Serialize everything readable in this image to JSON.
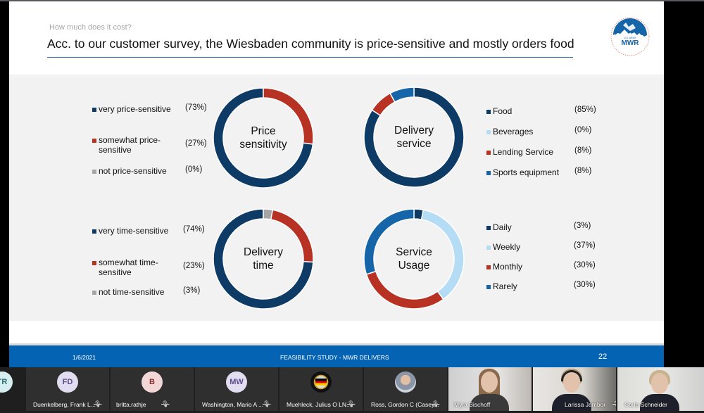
{
  "slide": {
    "subtitle": "How much does it cost?",
    "title": "Acc. to our customer survey, the Wiesbaden community is price-sensitive and mostly orders food",
    "logo": {
      "icon": "us-army-mwr-globe-logo",
      "top_text": "U.S. ARMY",
      "main_text": "MWR"
    },
    "colors": {
      "title_rule": "#2e75b6",
      "panel_bg": "#f2f2f2",
      "footer_bg": "#0563b4"
    },
    "footer": {
      "date": "1/6/2021",
      "center": "FEASIBILITY STUDY - MWR DELIVERS",
      "page": "22"
    }
  },
  "chart_data": [
    {
      "type": "pie",
      "variant": "donut",
      "title": "Price sensitivity",
      "legend_position": "left",
      "categories": [
        "very price-sensitive",
        "somewhat price-sensitive",
        "not price-sensitive"
      ],
      "legend_labels": [
        [
          "very price-sensitive"
        ],
        [
          "somewhat price-",
          "sensitive"
        ],
        [
          "not price-sensitive"
        ]
      ],
      "values": [
        73,
        27,
        0
      ],
      "value_labels": [
        "(73%)",
        "(27%)",
        "(0%)"
      ],
      "colors": [
        "#0d3b66",
        "#b83224",
        "#a5a5a5"
      ]
    },
    {
      "type": "pie",
      "variant": "donut",
      "title": "Delivery service",
      "legend_position": "right",
      "categories": [
        "Food",
        "Beverages",
        "Lending Service",
        "Sports equipment"
      ],
      "legend_labels": [
        [
          "Food"
        ],
        [
          "Beverages"
        ],
        [
          "Lending Service"
        ],
        [
          "Sports equipment"
        ]
      ],
      "values": [
        85,
        0,
        8,
        8
      ],
      "value_labels": [
        "(85%)",
        "(0%)",
        "(8%)",
        "(8%)"
      ],
      "colors": [
        "#0d3b66",
        "#b4dcf5",
        "#b83224",
        "#1565a8"
      ]
    },
    {
      "type": "pie",
      "variant": "donut",
      "title": "Delivery time",
      "legend_position": "left",
      "categories": [
        "very time-sensitive",
        "somewhat time-sensitive",
        "not time-sensitive"
      ],
      "legend_labels": [
        [
          "very time-sensitive"
        ],
        [
          "somewhat time-",
          "sensitive"
        ],
        [
          "not time-sensitive"
        ]
      ],
      "values": [
        74,
        23,
        3
      ],
      "value_labels": [
        "(74%)",
        "(23%)",
        "(3%)"
      ],
      "colors": [
        "#0d3b66",
        "#b83224",
        "#a5a5a5"
      ]
    },
    {
      "type": "pie",
      "variant": "donut",
      "title": "Service Usage",
      "legend_position": "right",
      "categories": [
        "Daily",
        "Weekly",
        "Monthly",
        "Rarely"
      ],
      "legend_labels": [
        [
          "Daily"
        ],
        [
          "Weekly"
        ],
        [
          "Monthly"
        ],
        [
          "Rarely"
        ]
      ],
      "values": [
        3,
        37,
        30,
        30
      ],
      "value_labels": [
        "(3%)",
        "(37%)",
        "(30%)",
        "(30%)"
      ],
      "colors": [
        "#0d3b66",
        "#b4dcf5",
        "#b83224",
        "#1565a8"
      ]
    }
  ],
  "participants": [
    {
      "initials": "TR",
      "name": "",
      "type": "avatar",
      "avatar_bg": "#d6eef0",
      "avatar_fg": "#2b6c73"
    },
    {
      "initials": "FD",
      "name": "Duenkelberg, Frank L...",
      "type": "avatar",
      "muted": true,
      "avatar_bg": "#e3ddf1",
      "avatar_fg": "#5b4e8a"
    },
    {
      "initials": "B",
      "name": "britta.rathje",
      "type": "avatar",
      "muted": true,
      "avatar_bg": "#f3d6d6",
      "avatar_fg": "#8a2a2a"
    },
    {
      "initials": "MW",
      "name": "Washington, Mario A ...",
      "type": "avatar",
      "muted": true,
      "avatar_bg": "#e3ddf1",
      "avatar_fg": "#5b4e8a"
    },
    {
      "initials": "",
      "name": "Muehleck, Julius O LN...",
      "type": "photo-avatar",
      "muted": true,
      "avatar_icon": "us-germany-flag-seal"
    },
    {
      "initials": "",
      "name": "Ross, Gordon C (Casey...",
      "type": "photo-avatar",
      "muted": true,
      "avatar_icon": "person-photo"
    },
    {
      "name": "Myra Bischoff",
      "type": "video"
    },
    {
      "name": "Larissa Jambor",
      "type": "video",
      "muted": true,
      "extra_icon": "pin-icon"
    },
    {
      "name": "Carla Schneider",
      "type": "video"
    }
  ],
  "icons": {
    "mute": "🎙̸"
  }
}
